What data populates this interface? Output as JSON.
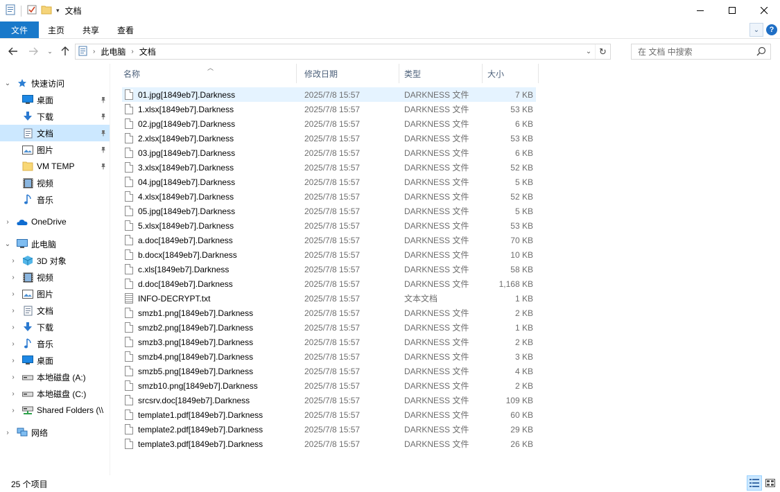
{
  "window": {
    "title": "文档"
  },
  "ribbon": {
    "file_tab": "文件",
    "tabs": [
      "主页",
      "共享",
      "查看"
    ]
  },
  "address": {
    "crumbs": [
      "此电脑",
      "文档"
    ],
    "search_placeholder": "在 文档 中搜索"
  },
  "nav": {
    "quick_access": "快速访问",
    "quick_items": [
      {
        "label": "桌面",
        "icon": "desktop-icon",
        "pinned": true
      },
      {
        "label": "下载",
        "icon": "download-icon",
        "pinned": true
      },
      {
        "label": "文档",
        "icon": "documents-icon",
        "pinned": true,
        "selected": true
      },
      {
        "label": "图片",
        "icon": "pictures-icon",
        "pinned": true
      },
      {
        "label": "VM TEMP",
        "icon": "folder-icon",
        "pinned": true
      },
      {
        "label": "视频",
        "icon": "videos-icon"
      },
      {
        "label": "音乐",
        "icon": "music-icon"
      }
    ],
    "onedrive": "OneDrive",
    "this_pc": "此电脑",
    "pc_items": [
      {
        "label": "3D 对象",
        "icon": "3d-objects-icon"
      },
      {
        "label": "视频",
        "icon": "videos-icon"
      },
      {
        "label": "图片",
        "icon": "pictures-icon"
      },
      {
        "label": "文档",
        "icon": "documents-icon"
      },
      {
        "label": "下载",
        "icon": "download-icon"
      },
      {
        "label": "音乐",
        "icon": "music-icon"
      },
      {
        "label": "桌面",
        "icon": "desktop-icon"
      },
      {
        "label": "本地磁盘 (A:)",
        "icon": "drive-icon"
      },
      {
        "label": "本地磁盘 (C:)",
        "icon": "drive-icon"
      },
      {
        "label": "Shared Folders (\\\\",
        "icon": "network-drive-icon"
      }
    ],
    "network": "网络"
  },
  "columns": {
    "name": "名称",
    "date": "修改日期",
    "type": "类型",
    "size": "大小"
  },
  "files": [
    {
      "name": "01.jpg[1849eb7].Darkness",
      "date": "2025/7/8 15:57",
      "type": "DARKNESS 文件",
      "size": "7 KB"
    },
    {
      "name": "1.xlsx[1849eb7].Darkness",
      "date": "2025/7/8 15:57",
      "type": "DARKNESS 文件",
      "size": "53 KB"
    },
    {
      "name": "02.jpg[1849eb7].Darkness",
      "date": "2025/7/8 15:57",
      "type": "DARKNESS 文件",
      "size": "6 KB"
    },
    {
      "name": "2.xlsx[1849eb7].Darkness",
      "date": "2025/7/8 15:57",
      "type": "DARKNESS 文件",
      "size": "53 KB"
    },
    {
      "name": "03.jpg[1849eb7].Darkness",
      "date": "2025/7/8 15:57",
      "type": "DARKNESS 文件",
      "size": "6 KB"
    },
    {
      "name": "3.xlsx[1849eb7].Darkness",
      "date": "2025/7/8 15:57",
      "type": "DARKNESS 文件",
      "size": "52 KB"
    },
    {
      "name": "04.jpg[1849eb7].Darkness",
      "date": "2025/7/8 15:57",
      "type": "DARKNESS 文件",
      "size": "5 KB"
    },
    {
      "name": "4.xlsx[1849eb7].Darkness",
      "date": "2025/7/8 15:57",
      "type": "DARKNESS 文件",
      "size": "52 KB"
    },
    {
      "name": "05.jpg[1849eb7].Darkness",
      "date": "2025/7/8 15:57",
      "type": "DARKNESS 文件",
      "size": "5 KB"
    },
    {
      "name": "5.xlsx[1849eb7].Darkness",
      "date": "2025/7/8 15:57",
      "type": "DARKNESS 文件",
      "size": "53 KB"
    },
    {
      "name": "a.doc[1849eb7].Darkness",
      "date": "2025/7/8 15:57",
      "type": "DARKNESS 文件",
      "size": "70 KB"
    },
    {
      "name": "b.docx[1849eb7].Darkness",
      "date": "2025/7/8 15:57",
      "type": "DARKNESS 文件",
      "size": "10 KB"
    },
    {
      "name": "c.xls[1849eb7].Darkness",
      "date": "2025/7/8 15:57",
      "type": "DARKNESS 文件",
      "size": "58 KB"
    },
    {
      "name": "d.doc[1849eb7].Darkness",
      "date": "2025/7/8 15:57",
      "type": "DARKNESS 文件",
      "size": "1,168 KB"
    },
    {
      "name": "INFO-DECRYPT.txt",
      "date": "2025/7/8 15:57",
      "type": "文本文档",
      "size": "1 KB",
      "txt": true
    },
    {
      "name": "smzb1.png[1849eb7].Darkness",
      "date": "2025/7/8 15:57",
      "type": "DARKNESS 文件",
      "size": "2 KB"
    },
    {
      "name": "smzb2.png[1849eb7].Darkness",
      "date": "2025/7/8 15:57",
      "type": "DARKNESS 文件",
      "size": "1 KB"
    },
    {
      "name": "smzb3.png[1849eb7].Darkness",
      "date": "2025/7/8 15:57",
      "type": "DARKNESS 文件",
      "size": "2 KB"
    },
    {
      "name": "smzb4.png[1849eb7].Darkness",
      "date": "2025/7/8 15:57",
      "type": "DARKNESS 文件",
      "size": "3 KB"
    },
    {
      "name": "smzb5.png[1849eb7].Darkness",
      "date": "2025/7/8 15:57",
      "type": "DARKNESS 文件",
      "size": "4 KB"
    },
    {
      "name": "smzb10.png[1849eb7].Darkness",
      "date": "2025/7/8 15:57",
      "type": "DARKNESS 文件",
      "size": "2 KB"
    },
    {
      "name": "srcsrv.doc[1849eb7].Darkness",
      "date": "2025/7/8 15:57",
      "type": "DARKNESS 文件",
      "size": "109 KB"
    },
    {
      "name": "template1.pdf[1849eb7].Darkness",
      "date": "2025/7/8 15:57",
      "type": "DARKNESS 文件",
      "size": "60 KB"
    },
    {
      "name": "template2.pdf[1849eb7].Darkness",
      "date": "2025/7/8 15:57",
      "type": "DARKNESS 文件",
      "size": "29 KB"
    },
    {
      "name": "template3.pdf[1849eb7].Darkness",
      "date": "2025/7/8 15:57",
      "type": "DARKNESS 文件",
      "size": "26 KB"
    }
  ],
  "status": {
    "item_count": "25 个项目"
  },
  "colors": {
    "accent": "#1979ca",
    "selection": "#cce8ff",
    "hover": "#e5f3ff"
  }
}
